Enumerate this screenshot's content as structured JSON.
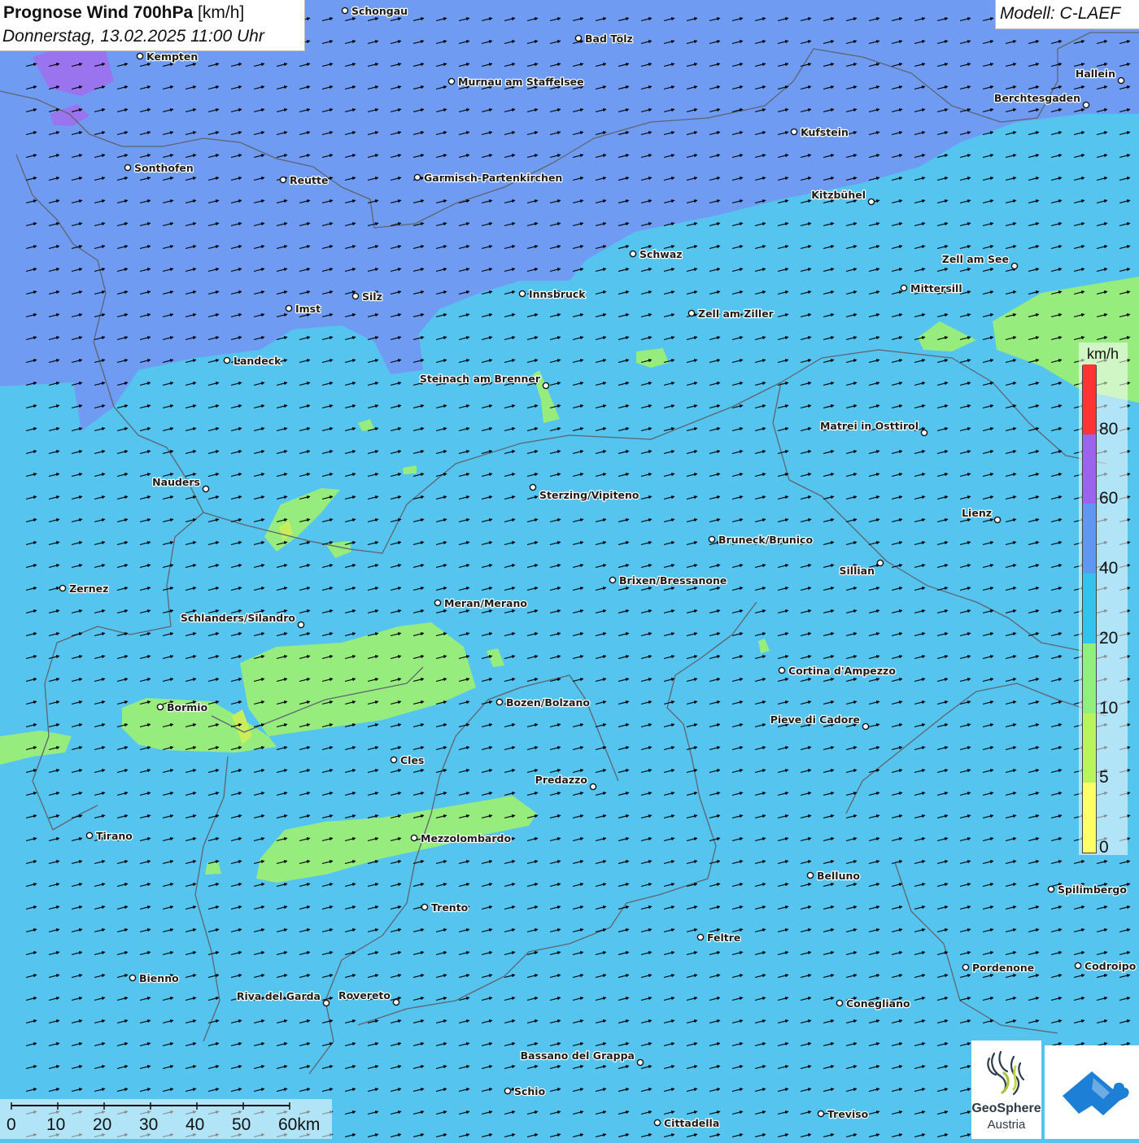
{
  "header": {
    "title_bold": "Prognose Wind 700hPa",
    "title_unit": "[km/h]",
    "datetime": "Donnerstag, 13.02.2025 11:00 Uhr",
    "model": "Modell: C-LAEF"
  },
  "legend": {
    "unit": "km/h",
    "scale": [
      {
        "from": 0,
        "to": 5,
        "color": "#ffff66"
      },
      {
        "from": 5,
        "to": 10,
        "color": "#b8f55a"
      },
      {
        "from": 10,
        "to": 20,
        "color": "#8ff07e"
      },
      {
        "from": 20,
        "to": 40,
        "color": "#33c4ee"
      },
      {
        "from": 40,
        "to": 60,
        "color": "#5f97f3"
      },
      {
        "from": 60,
        "to": 80,
        "color": "#9b63ee"
      },
      {
        "from": 80,
        "to": 100,
        "color": "#ff3333"
      }
    ],
    "tick_labels": [
      "0",
      "5",
      "10",
      "20",
      "40",
      "60",
      "80"
    ]
  },
  "scalebar": {
    "labels": [
      "0",
      "10",
      "20",
      "30",
      "40",
      "50",
      "60km"
    ]
  },
  "wind": {
    "direction": "from west-southwest"
  },
  "cities": [
    {
      "name": "Schongau"
    },
    {
      "name": "Bad Tölz"
    },
    {
      "name": "Kempten"
    },
    {
      "name": "Murnau am Staffelsee"
    },
    {
      "name": "Hallein"
    },
    {
      "name": "Berchtesgaden"
    },
    {
      "name": "Kufstein"
    },
    {
      "name": "Sonthofen"
    },
    {
      "name": "Reutte"
    },
    {
      "name": "Garmisch-Partenkirchen"
    },
    {
      "name": "Kitzbühel"
    },
    {
      "name": "Schwaz"
    },
    {
      "name": "Zell am See"
    },
    {
      "name": "Innsbruck"
    },
    {
      "name": "Mittersill"
    },
    {
      "name": "Imst"
    },
    {
      "name": "Silz"
    },
    {
      "name": "Zell am Ziller"
    },
    {
      "name": "Landeck"
    },
    {
      "name": "Steinach am Brenner"
    },
    {
      "name": "Matrei in Osttirol"
    },
    {
      "name": "Nauders"
    },
    {
      "name": "Sterzing/Vipiteno"
    },
    {
      "name": "Lienz"
    },
    {
      "name": "Bruneck/Brunico"
    },
    {
      "name": "Sillian"
    },
    {
      "name": "Brixen/Bressanone"
    },
    {
      "name": "Zernez"
    },
    {
      "name": "Meran/Merano"
    },
    {
      "name": "Schlanders/Silandro"
    },
    {
      "name": "Cortina d'Ampezzo"
    },
    {
      "name": "Bozen/Bolzano"
    },
    {
      "name": "Bormio"
    },
    {
      "name": "Pieve di Cadore"
    },
    {
      "name": "Cles"
    },
    {
      "name": "Predazzo"
    },
    {
      "name": "Tirano"
    },
    {
      "name": "Mezzolombardo"
    },
    {
      "name": "Belluno"
    },
    {
      "name": "Spilimbergo"
    },
    {
      "name": "Trento"
    },
    {
      "name": "Feltre"
    },
    {
      "name": "Pordenone"
    },
    {
      "name": "Codroipo"
    },
    {
      "name": "Bienno"
    },
    {
      "name": "Riva del Garda"
    },
    {
      "name": "Rovereto"
    },
    {
      "name": "Conegliano"
    },
    {
      "name": "Bassano del Grappa"
    },
    {
      "name": "Schio"
    },
    {
      "name": "Treviso"
    },
    {
      "name": "Cittadella"
    }
  ],
  "logos": {
    "geosphere_name": "GeoSphere",
    "geosphere_sub": "Austria"
  }
}
